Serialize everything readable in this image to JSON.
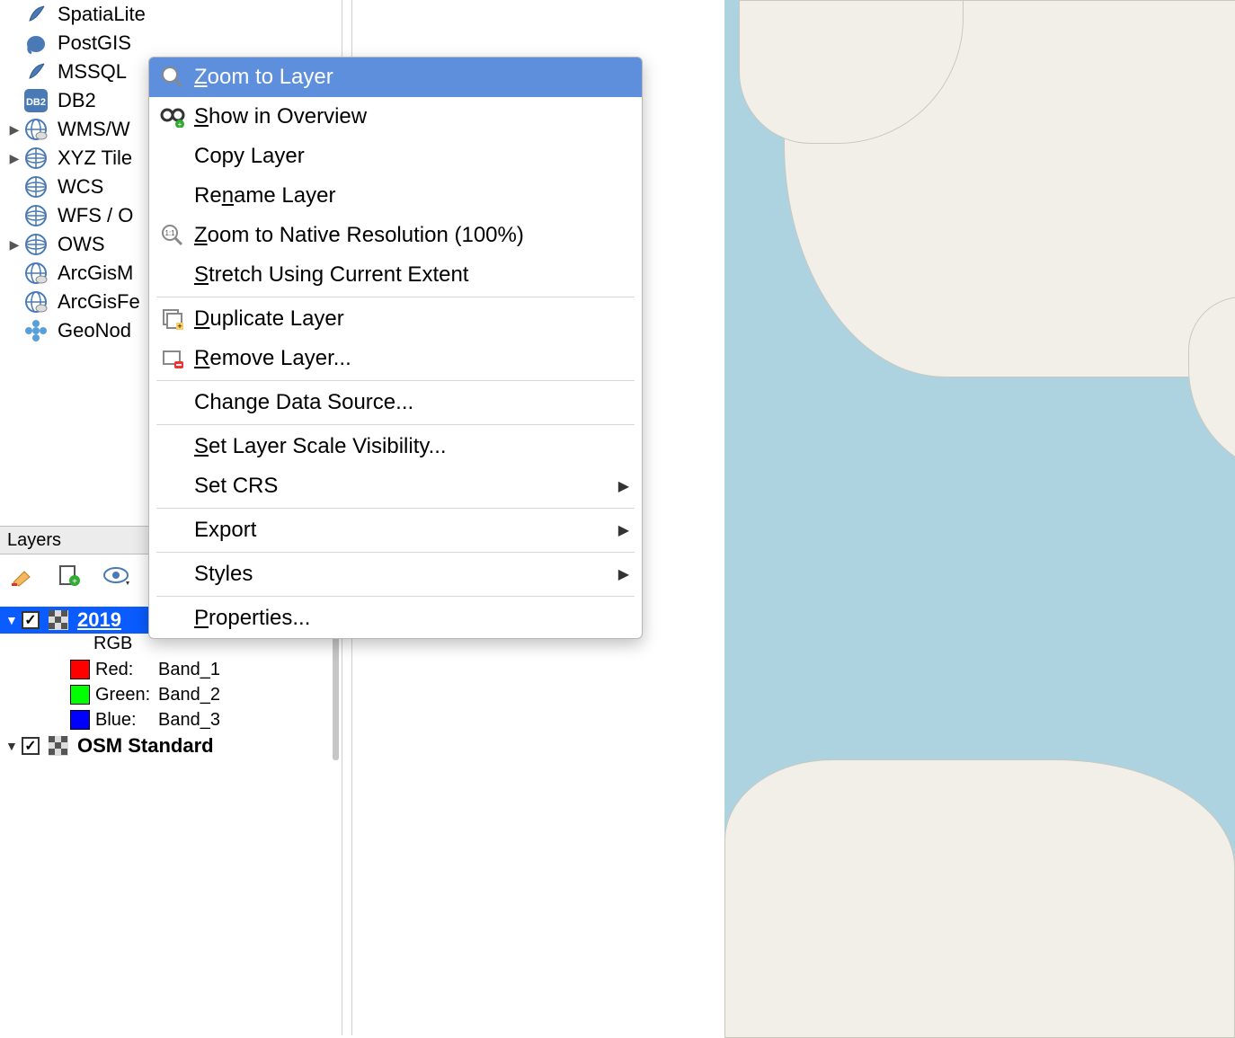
{
  "browser": {
    "items": [
      {
        "label": "SpatiaLite",
        "expandable": false
      },
      {
        "label": "PostGIS",
        "expandable": false
      },
      {
        "label": "MSSQL",
        "expandable": false
      },
      {
        "label": "DB2",
        "expandable": false
      },
      {
        "label": "WMS/W",
        "expandable": true
      },
      {
        "label": "XYZ Tile",
        "expandable": true
      },
      {
        "label": "WCS",
        "expandable": false
      },
      {
        "label": "WFS / O",
        "expandable": false
      },
      {
        "label": "OWS",
        "expandable": true
      },
      {
        "label": "ArcGisM",
        "expandable": false
      },
      {
        "label": "ArcGisFe",
        "expandable": false
      },
      {
        "label": "GeoNod",
        "expandable": false
      }
    ]
  },
  "layers_panel": {
    "title": "Layers",
    "layer1": {
      "name": "2019",
      "sub": "RGB",
      "bands": [
        {
          "color": "#ff0000",
          "label": "Red:",
          "value": "Band_1"
        },
        {
          "color": "#00ff00",
          "label": "Green:",
          "value": "Band_2"
        },
        {
          "color": "#0000ff",
          "label": "Blue:",
          "value": "Band_3"
        }
      ]
    },
    "layer2": {
      "name": "OSM Standard"
    }
  },
  "context_menu": {
    "items": [
      {
        "label": "Zoom to Layer",
        "icon": "zoom-layer",
        "highlighted": true,
        "u": 0
      },
      {
        "label": "Show in Overview",
        "icon": "overview",
        "u": 0
      },
      {
        "label": "Copy Layer"
      },
      {
        "label": "Rename Layer",
        "u": 2
      },
      {
        "label": "Zoom to Native Resolution (100%)",
        "icon": "zoom-native",
        "u": 0
      },
      {
        "label": "Stretch Using Current Extent",
        "u": 0
      },
      {
        "sep": true
      },
      {
        "label": "Duplicate Layer",
        "icon": "duplicate",
        "u": 0
      },
      {
        "label": "Remove Layer...",
        "icon": "remove",
        "u": 0
      },
      {
        "sep": true
      },
      {
        "label": "Change Data Source..."
      },
      {
        "sep": true
      },
      {
        "label": "Set Layer Scale Visibility...",
        "u": 0
      },
      {
        "label": "Set CRS",
        "submenu": true
      },
      {
        "sep": true
      },
      {
        "label": "Export",
        "submenu": true
      },
      {
        "sep": true
      },
      {
        "label": "Styles",
        "submenu": true
      },
      {
        "sep": true
      },
      {
        "label": "Properties...",
        "u": 0
      }
    ]
  }
}
